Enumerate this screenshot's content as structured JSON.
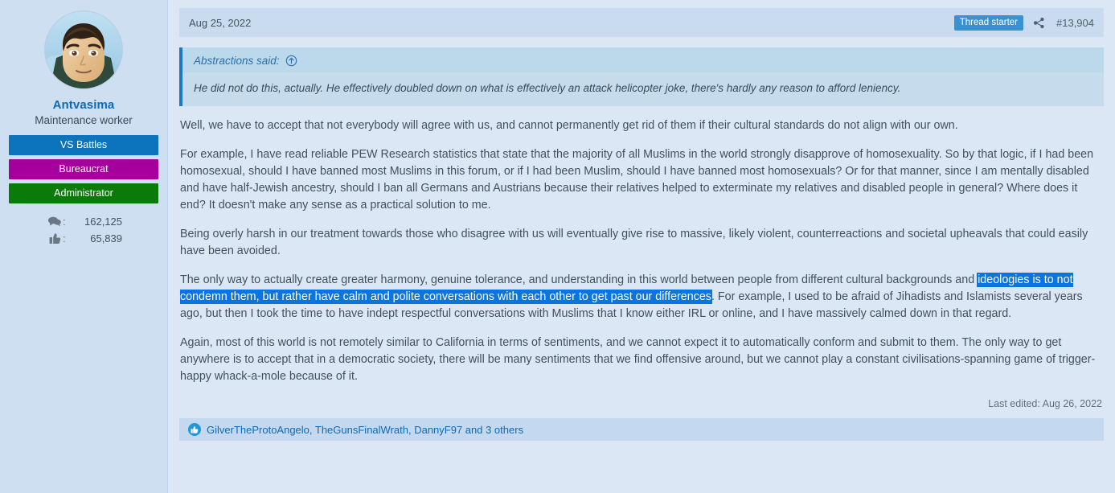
{
  "user": {
    "name": "Antvasima",
    "title": "Maintenance worker",
    "avatar_alt": "user-avatar",
    "banners": [
      {
        "label": "VS Battles",
        "color": "#0b74bd"
      },
      {
        "label": "Bureaucrat",
        "color": "#a5009c"
      },
      {
        "label": "Administrator",
        "color": "#0b7a0b"
      }
    ],
    "stats": [
      {
        "icon": "messages-icon",
        "separator": ":",
        "value": "162,125"
      },
      {
        "icon": "likes-icon",
        "separator": ":",
        "value": "65,839"
      }
    ]
  },
  "post": {
    "date": "Aug 25, 2022",
    "thread_starter_badge": "Thread starter",
    "share_icon": "share-icon",
    "post_number": "#13,904",
    "last_edited": "Last edited: Aug 26, 2022",
    "quote": {
      "author_said": "Abstractions said:",
      "jump_icon": "circle-up-arrow-icon",
      "text": "He did not do this, actually. He effectively doubled down on what is effectively an attack helicopter joke, there's hardly any reason to afford leniency."
    },
    "paragraphs": [
      {
        "text": "Well, we have to accept that not everybody will agree with us, and cannot permanently get rid of them if their cultural standards do not align with our own."
      },
      {
        "text": "For example, I have read reliable PEW Research statistics that state that the majority of all Muslims in the world strongly disapprove of homosexuality. So by that logic, if I had been homosexual, should I have banned most Muslims in this forum, or if I had been Muslim, should I have banned most homosexuals? Or for that manner, since I am mentally disabled and have half-Jewish ancestry, should I ban all Germans and Austrians because their relatives helped to exterminate my relatives and disabled people in general? Where does it end? It doesn't make any sense as a practical solution to me."
      },
      {
        "text": "Being overly harsh in our treatment towards those who disagree with us will eventually give rise to massive, likely violent, counterreactions and societal upheavals that could easily have been avoided."
      },
      {
        "prefix": "The only way to actually create greater harmony, genuine tolerance, and understanding in this world between people from different cultural backgrounds and ",
        "selected": "ideologies is to not condemn them, but rather have calm and polite conversations with each other to get past our differences",
        "suffix": ". For example, I used to be afraid of Jihadists and Islamists several years ago, but then I took the time to have indept respectful conversations with Muslims that I know either IRL or online, and I have massively calmed down in that regard."
      },
      {
        "text": "Again, most of this world is not remotely similar to California in terms of sentiments, and we cannot expect it to automatically conform and submit to them. The only way to get anywhere is to accept that in a democratic society, there will be many sentiments that we find offensive around, but we cannot play a constant civilisations-spanning game of trigger-happy whack-a-mole because of it."
      }
    ],
    "reactions": {
      "icon": "thumbs-up-reaction-icon",
      "names": "GilverTheProtoAngelo, TheGunsFinalWrath, DannyF97 and 3 others"
    }
  },
  "colors": {
    "page_background": "#dce7f5",
    "sidebar_background": "#cfdff2",
    "header_bar": "#c9dcef",
    "quote_background": "#c6dced",
    "quote_border": "#1a7ac0",
    "link": "#1069b4",
    "selection": "#0a74e0",
    "badge": "#3991d0",
    "reactions_bar": "#c4d9ef"
  }
}
